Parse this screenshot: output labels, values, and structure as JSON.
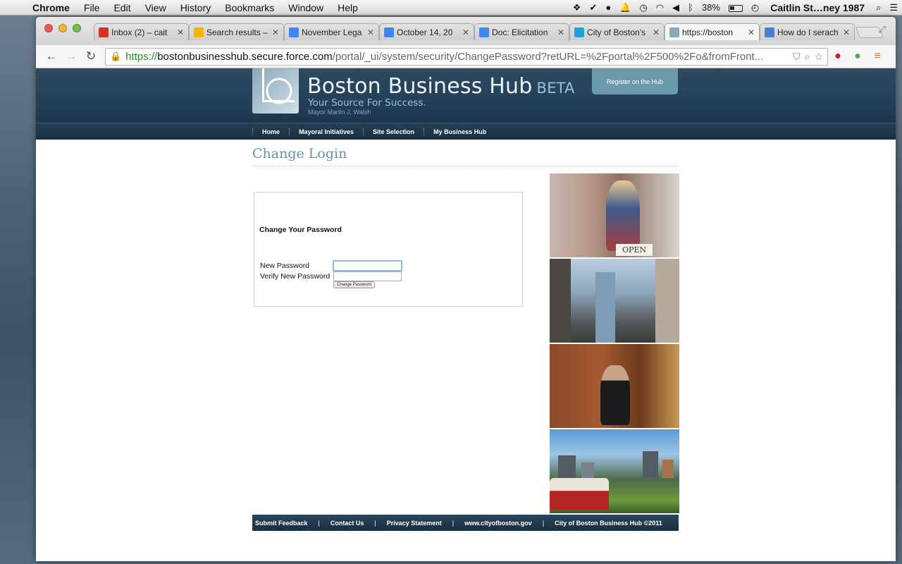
{
  "menubar": {
    "app": "Chrome",
    "items": [
      "File",
      "Edit",
      "View",
      "History",
      "Bookmarks",
      "Window",
      "Help"
    ],
    "battery": "38%",
    "user": "Caitlin St…ney 1987"
  },
  "browser": {
    "tabs": [
      {
        "title": "Inbox (2) – cait",
        "favicon": "gmail-icon",
        "color": "#d93025"
      },
      {
        "title": "Search results –",
        "favicon": "drive-icon",
        "color": "#f4b400"
      },
      {
        "title": "November Lega",
        "favicon": "docs-icon",
        "color": "#4285f4"
      },
      {
        "title": "October 14, 20",
        "favicon": "docs-icon",
        "color": "#4285f4"
      },
      {
        "title": "Doc: Elicitation",
        "favicon": "docs-icon",
        "color": "#4285f4"
      },
      {
        "title": "City of Boston's",
        "favicon": "salesforce-icon",
        "color": "#1ea0dc"
      },
      {
        "title": "https://boston",
        "favicon": "page-icon",
        "color": "#8aa8b8"
      },
      {
        "title": "How do I serach",
        "favicon": "help-icon",
        "color": "#4a7fd0"
      }
    ],
    "active_tab": 6,
    "url": {
      "proto": "https://",
      "host": "bostonbusinesshub.secure.force.com",
      "path": "/portal/_ui/system/security/ChangePassword?retURL=%2Fportal%2F500%2Fo&fromFront..."
    }
  },
  "site": {
    "title": "Boston Business Hub",
    "beta": "BETA",
    "tagline": "Your Source For Success.",
    "mayor": "Mayor Martin J. Walsh",
    "register": "Register on the Hub",
    "nav": [
      "Home",
      "Mayoral Initiatives",
      "Site Selection",
      "My Business Hub"
    ]
  },
  "content": {
    "title": "Change Login",
    "heading": "Change Your Password",
    "new_password_label": "New Password",
    "verify_password_label": "Verify New Password",
    "new_password_value": "",
    "verify_password_value": "",
    "button": "Change Password",
    "open_sign": "OPEN"
  },
  "footer": {
    "links": [
      "Submit Feedback",
      "Contact Us",
      "Privacy Statement",
      "www.cityofboston.gov",
      "City of Boston Business Hub ©2011"
    ]
  }
}
